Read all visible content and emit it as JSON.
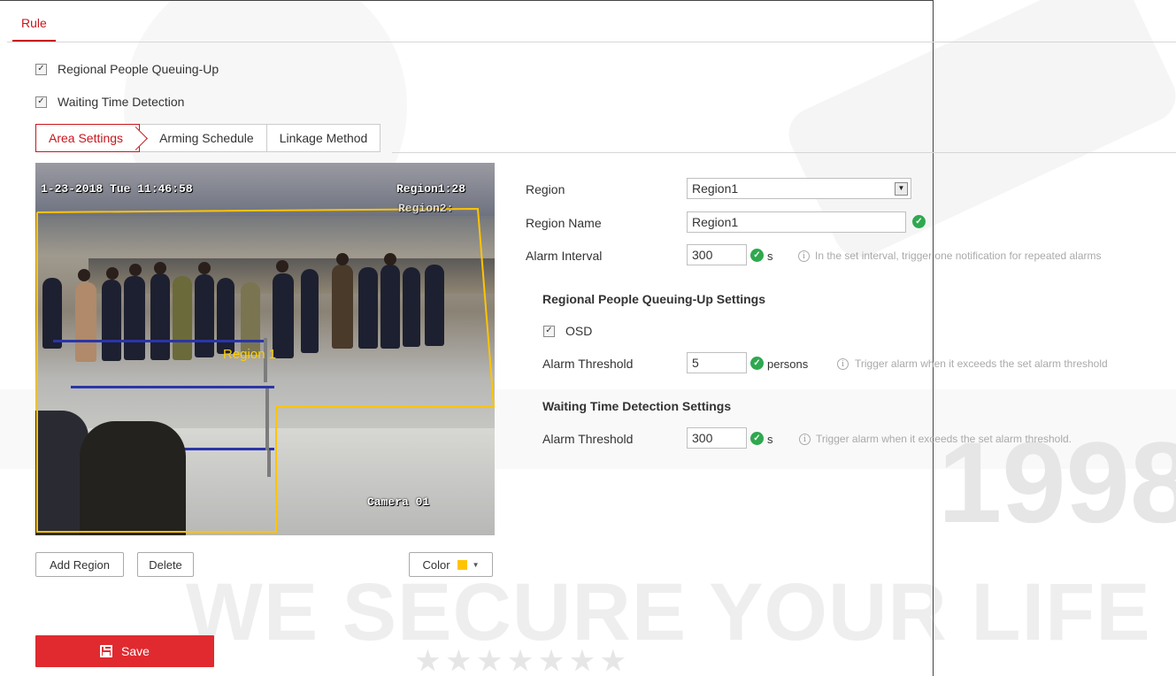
{
  "page": {
    "tab_rule": "Rule"
  },
  "options": {
    "queuing": {
      "label": "Regional People Queuing-Up",
      "checked": true
    },
    "waiting": {
      "label": "Waiting Time Detection",
      "checked": true
    }
  },
  "subtabs": [
    {
      "label": "Area Settings",
      "active": true
    },
    {
      "label": "Arming Schedule",
      "active": false
    },
    {
      "label": "Linkage Method",
      "active": false
    }
  ],
  "video": {
    "timestamp": "1-23-2018 Tue 11:46:58",
    "region_osd_line1": "Region1:28",
    "region_osd_line2": "Region2:",
    "camera_name": "Camera 01",
    "region_overlay_label": "Region 1",
    "region_color": "#ffc400"
  },
  "area_buttons": {
    "add_region": "Add Region",
    "delete": "Delete",
    "color": "Color",
    "color_value": "#ffc400"
  },
  "settings": {
    "region": {
      "label": "Region",
      "value": "Region1"
    },
    "region_name": {
      "label": "Region Name",
      "value": "Region1"
    },
    "alarm_interval": {
      "label": "Alarm Interval",
      "value": "300",
      "unit": "s",
      "hint": "In the set interval, trigger one notification for repeated alarms"
    },
    "queuing_section": {
      "title": "Regional People Queuing-Up Settings",
      "osd_label": "OSD",
      "osd_checked": true,
      "threshold_label": "Alarm Threshold",
      "threshold_value": "5",
      "threshold_unit": "persons",
      "threshold_hint": "Trigger alarm when it exceeds the set alarm threshold"
    },
    "waiting_section": {
      "title": "Waiting Time Detection Settings",
      "threshold_label": "Alarm Threshold",
      "threshold_value": "300",
      "threshold_unit": "s",
      "threshold_hint": "Trigger alarm when it exceeds the set alarm threshold."
    }
  },
  "actions": {
    "save": "Save"
  },
  "watermark": {
    "slogan": "WE SECURE YOUR LIFE",
    "year": "1998",
    "stars": "★★★★★★★"
  },
  "icons": {
    "check": "green-check-icon",
    "info": "info-icon",
    "save": "save-icon",
    "dropdown": "chevron-down-icon"
  },
  "colors": {
    "accent": "#c8161d",
    "save_button": "#e02a2f",
    "ok_green": "#2fa84f",
    "region_yellow": "#ffc400"
  }
}
